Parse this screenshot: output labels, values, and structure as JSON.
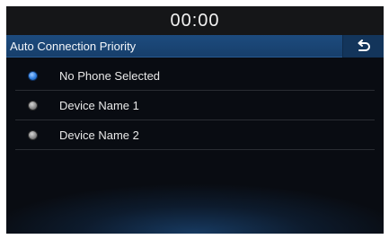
{
  "status": {
    "clock": "00:00"
  },
  "header": {
    "title": "Auto Connection Priority",
    "back_icon": "back-arrow-icon"
  },
  "list": {
    "items": [
      {
        "label": "No Phone Selected",
        "selected": true
      },
      {
        "label": "Device Name 1",
        "selected": false
      },
      {
        "label": "Device Name 2",
        "selected": false
      }
    ]
  },
  "colors": {
    "accent": "#1d4b7e",
    "selected_radio": "#2f7fe0",
    "background": "#090c12"
  }
}
